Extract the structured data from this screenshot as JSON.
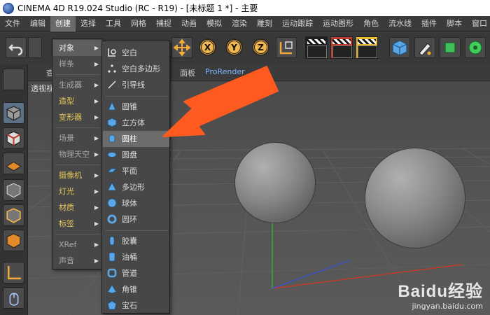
{
  "window": {
    "title": "CINEMA 4D R19.024 Studio (RC - R19) - [未标题 1 *] - 主要"
  },
  "menubar": {
    "items": [
      "文件",
      "编辑",
      "创建",
      "选择",
      "工具",
      "网格",
      "捕捉",
      "动画",
      "模拟",
      "渲染",
      "雕刻",
      "运动跟踪",
      "运动图形",
      "角色",
      "流水线",
      "插件",
      "脚本",
      "窗口"
    ],
    "active": "创建"
  },
  "toolbar": {
    "axis_labels": [
      "X",
      "Y",
      "Z"
    ]
  },
  "viewport": {
    "label": "透视视",
    "menu_items": [
      "查",
      "面板",
      "ProRender"
    ]
  },
  "create_menu": {
    "items": [
      {
        "label": "对象",
        "highlighted": true,
        "has_submenu": true,
        "color": "white"
      },
      {
        "label": "样条",
        "has_submenu": true,
        "color": "gray"
      },
      {
        "label": "生成器",
        "has_submenu": true,
        "color": "gray"
      },
      {
        "label": "造型",
        "has_submenu": true,
        "color": "yellow"
      },
      {
        "label": "变形器",
        "has_submenu": true,
        "color": "yellow"
      },
      {
        "label": "场景",
        "has_submenu": true,
        "color": "gray"
      },
      {
        "label": "物理天空",
        "has_submenu": true,
        "color": "gray"
      },
      {
        "label": "摄像机",
        "has_submenu": true,
        "color": "yellow"
      },
      {
        "label": "灯光",
        "has_submenu": true,
        "color": "yellow"
      },
      {
        "label": "材质",
        "has_submenu": true,
        "color": "yellow"
      },
      {
        "label": "标签",
        "has_submenu": true,
        "color": "yellow"
      },
      {
        "label": "XRef",
        "has_submenu": true,
        "color": "gray"
      },
      {
        "label": "声音",
        "has_submenu": true,
        "color": "gray"
      }
    ]
  },
  "object_submenu": {
    "items": [
      {
        "label": "空白",
        "icon": "null-object-icon"
      },
      {
        "label": "空白多边形",
        "icon": "polygon-object-icon"
      },
      {
        "label": "引导线",
        "icon": "guide-line-icon"
      },
      {
        "label": "圆锥",
        "icon": "cone-icon"
      },
      {
        "label": "立方体",
        "icon": "cube-icon"
      },
      {
        "label": "圆柱",
        "icon": "cylinder-icon",
        "highlighted": true
      },
      {
        "label": "圆盘",
        "icon": "disc-icon"
      },
      {
        "label": "平面",
        "icon": "plane-icon"
      },
      {
        "label": "多边形",
        "icon": "polygon-icon"
      },
      {
        "label": "球体",
        "icon": "sphere-icon"
      },
      {
        "label": "圆环",
        "icon": "torus-icon"
      },
      {
        "label": "胶囊",
        "icon": "capsule-icon"
      },
      {
        "label": "油桶",
        "icon": "oil-tank-icon"
      },
      {
        "label": "管道",
        "icon": "tube-icon"
      },
      {
        "label": "角锥",
        "icon": "pyramid-icon"
      },
      {
        "label": "宝石",
        "icon": "platonic-icon"
      }
    ]
  },
  "watermark": {
    "logo": "Baidu经验",
    "url": "jingyan.baidu.com"
  },
  "colors": {
    "accent": "#ff5a1f",
    "highlight": "#6c6c6c",
    "axis_y": "#2fbf2f",
    "axis_x": "#d9331f",
    "axis_z": "#3550d8"
  }
}
